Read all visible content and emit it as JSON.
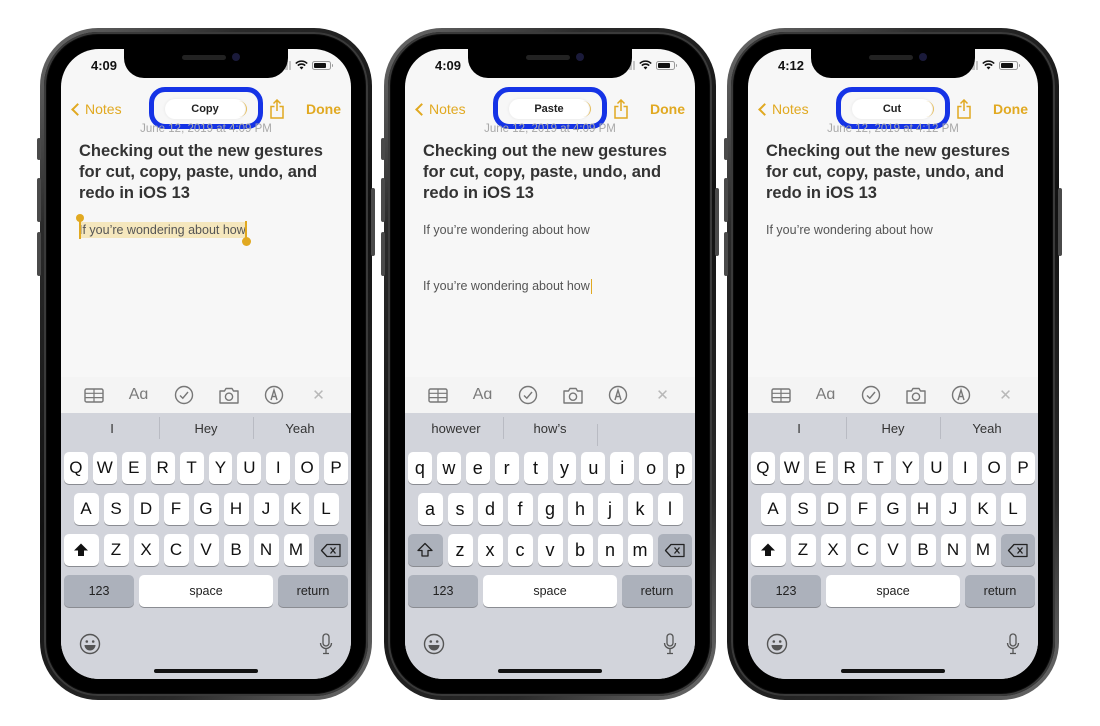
{
  "colors": {
    "accent": "#e1a921",
    "highlight_ring": "#1533e6",
    "selection": "#f5e7bd",
    "keyboard_bg": "#d2d4db"
  },
  "phones": [
    {
      "status": {
        "time": "4:09"
      },
      "nav": {
        "back_label": "Notes",
        "action_pill": "Copy",
        "done_label": "Done"
      },
      "note": {
        "date": "June 12, 2019 at 4:09 PM",
        "title": "Checking out the new gestures for cut, copy, paste, undo, and redo in  iOS 13",
        "lines": [
          "If you’re wondering about how"
        ],
        "selected_text": "If you’re wondering about how"
      },
      "suggestions": [
        "I",
        "Hey",
        "Yeah"
      ],
      "keyboard_case": "upper",
      "shift_state": "on"
    },
    {
      "status": {
        "time": "4:09"
      },
      "nav": {
        "back_label": "Notes",
        "action_pill": "Paste",
        "done_label": "Done"
      },
      "note": {
        "date": "June 12, 2019 at 4:09 PM",
        "title": "Checking out the new gestures for cut, copy, paste, undo, and redo in  iOS 13",
        "lines": [
          "If you’re wondering about how",
          "If you’re wondering about how"
        ]
      },
      "suggestions": [
        "however",
        "how’s",
        ""
      ],
      "keyboard_case": "lower",
      "shift_state": "off"
    },
    {
      "status": {
        "time": "4:12"
      },
      "nav": {
        "back_label": "Notes",
        "action_pill": "Cut",
        "done_label": "Done"
      },
      "note": {
        "date": "June 12, 2019 at 4:12 PM",
        "title": "Checking out the new gestures for cut, copy, paste, undo, and redo in  iOS 13",
        "lines": [
          "If you’re wondering about how"
        ]
      },
      "suggestions": [
        "I",
        "Hey",
        "Yeah"
      ],
      "keyboard_case": "upper",
      "shift_state": "on"
    }
  ],
  "toolbar_icons": [
    "table-icon",
    "text-format-icon",
    "checklist-icon",
    "camera-icon",
    "markup-icon",
    "close-icon"
  ],
  "toolbar_glyphs": {
    "text_format": "Aɑ",
    "close": "✕"
  },
  "keyboard": {
    "rows_upper": [
      [
        "Q",
        "W",
        "E",
        "R",
        "T",
        "Y",
        "U",
        "I",
        "O",
        "P"
      ],
      [
        "A",
        "S",
        "D",
        "F",
        "G",
        "H",
        "J",
        "K",
        "L"
      ],
      [
        "Z",
        "X",
        "C",
        "V",
        "B",
        "N",
        "M"
      ]
    ],
    "rows_lower": [
      [
        "q",
        "w",
        "e",
        "r",
        "t",
        "y",
        "u",
        "i",
        "o",
        "p"
      ],
      [
        "a",
        "s",
        "d",
        "f",
        "g",
        "h",
        "j",
        "k",
        "l"
      ],
      [
        "z",
        "x",
        "c",
        "v",
        "b",
        "n",
        "m"
      ]
    ],
    "numbers_label": "123",
    "space_label": "space",
    "return_label": "return"
  }
}
